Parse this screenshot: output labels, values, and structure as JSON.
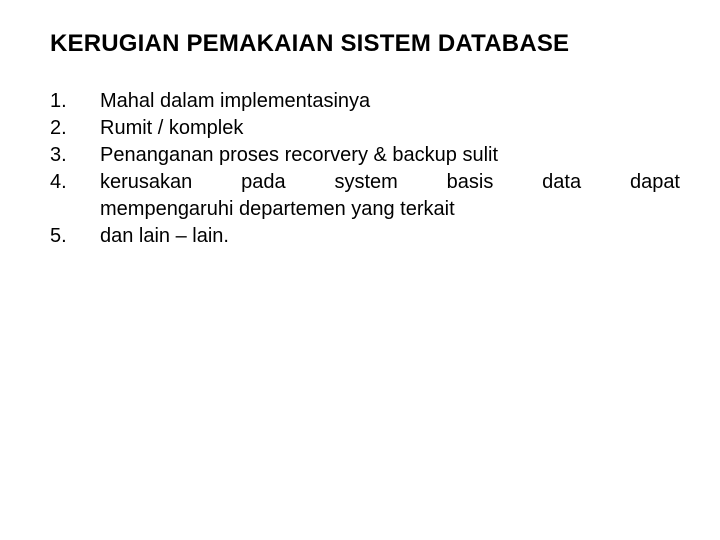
{
  "title": "KERUGIAN PEMAKAIAN SISTEM DATABASE",
  "items": [
    {
      "num": "1.",
      "text": "Mahal dalam implementasinya"
    },
    {
      "num": "2.",
      "text": "Rumit / komplek"
    },
    {
      "num": "3.",
      "text": "Penanganan proses recorvery & backup sulit"
    },
    {
      "num": "4.",
      "line1": "kerusakan pada system basis data dapat",
      "line2": "mempengaruhi departemen yang terkait"
    },
    {
      "num": "5.",
      "text": "dan lain – lain."
    }
  ]
}
